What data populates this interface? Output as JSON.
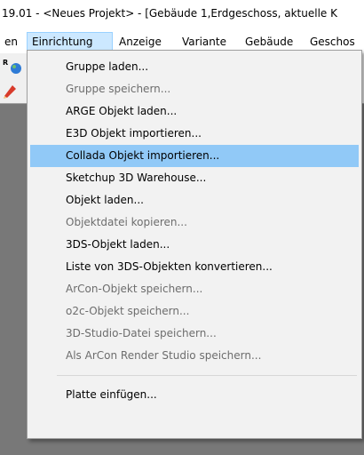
{
  "window": {
    "title": "19.01 - <Neues Projekt> - [Gebäude 1,Erdgeschoss, aktuelle K"
  },
  "menubar": {
    "items": [
      {
        "label": "en"
      },
      {
        "label": "Einrichtung",
        "active": true
      },
      {
        "label": "Anzeige"
      },
      {
        "label": "Variante"
      },
      {
        "label": "Gebäude"
      },
      {
        "label": "Geschos"
      }
    ]
  },
  "dropdown": {
    "items": [
      {
        "label": "Gruppe laden...",
        "enabled": true
      },
      {
        "label": "Gruppe speichern...",
        "enabled": false
      },
      {
        "label": "ARGE Objekt laden...",
        "enabled": true
      },
      {
        "label": "E3D Objekt importieren...",
        "enabled": true
      },
      {
        "label": "Collada Objekt importieren...",
        "enabled": true,
        "highlighted": true
      },
      {
        "label": "Sketchup 3D Warehouse...",
        "enabled": true
      },
      {
        "label": "Objekt laden...",
        "enabled": true
      },
      {
        "label": "Objektdatei kopieren...",
        "enabled": false
      },
      {
        "label": "3DS-Objekt laden...",
        "enabled": true
      },
      {
        "label": "Liste von 3DS-Objekten konvertieren...",
        "enabled": true
      },
      {
        "label": "ArCon-Objekt speichern...",
        "enabled": false
      },
      {
        "label": "o2c-Objekt speichern...",
        "enabled": false
      },
      {
        "label": "3D-Studio-Datei speichern...",
        "enabled": false
      },
      {
        "label": "Als ArCon Render Studio speichern...",
        "enabled": false
      },
      {
        "label": "Platte einfügen...",
        "enabled": true
      }
    ]
  },
  "toolbar": {
    "icons": [
      "app-r-icon",
      "globe-icon",
      "pencil-icon",
      "arrow-icon"
    ]
  },
  "colors": {
    "workspace": "#787878",
    "highlight": "#91c9f7",
    "menu_active": "#cce8ff",
    "disabled_text": "#6d6d6d"
  }
}
